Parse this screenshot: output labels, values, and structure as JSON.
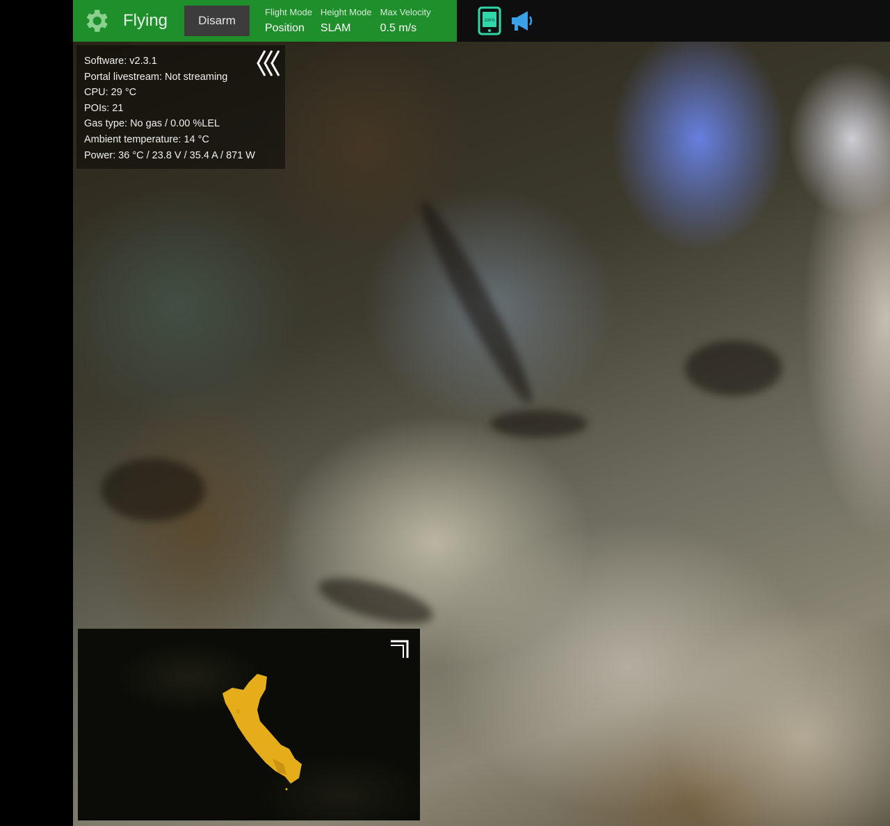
{
  "topbar": {
    "state": "Flying",
    "disarm_label": "Disarm",
    "flight_mode": {
      "label": "Flight Mode",
      "value": "Position"
    },
    "height_mode": {
      "label": "Height Mode",
      "value": "SLAM"
    },
    "max_velocity": {
      "label": "Max Velocity",
      "value": "0.5 m/s"
    },
    "tablet_battery": "100%",
    "status_color": "#1e8f2a",
    "icons": [
      "gear-icon",
      "tablet-battery-icon",
      "megaphone-icon"
    ]
  },
  "info_panel": {
    "lines": [
      "Software: v2.3.1",
      "Portal livestream: Not streaming",
      "CPU: 29 °C",
      "POIs: 21",
      "Gas type: No gas / 0.00 %LEL",
      "Ambient temperature: 14 °C",
      "Power: 36 °C / 23.8 V / 35.4 A / 871 W"
    ],
    "collapse_icon": "triple-chevron-left-icon"
  },
  "minimap": {
    "expand_icon": "expand-corner-icon",
    "pointcloud_color": "#f2b61c"
  }
}
